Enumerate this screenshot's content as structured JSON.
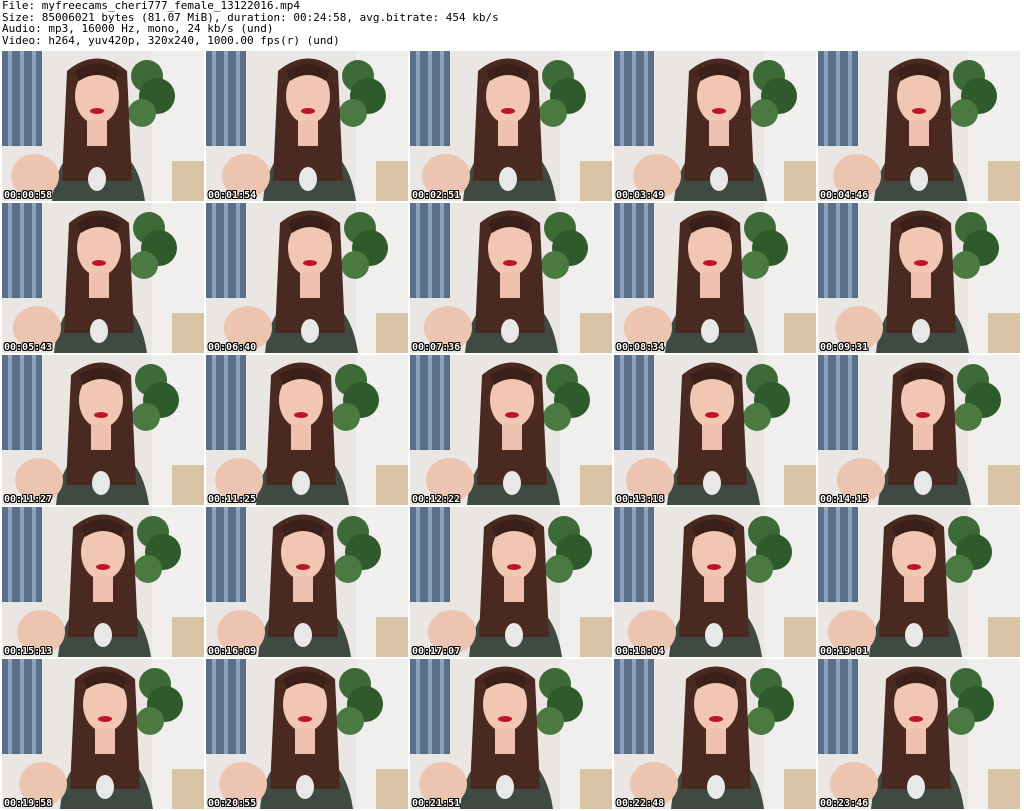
{
  "header": {
    "file_line": "File: myfreecams_cheri777_female_13122016.mp4",
    "size_line": "Size: 85006021 bytes (81.07 MiB), duration: 00:24:58, avg.bitrate: 454 kb/s",
    "audio_line": "Audio: mp3, 16000 Hz, mono, 24 kb/s (und)",
    "video_line": "Video: h264, yuv420p, 320x240, 1000.00 fps(r) (und)"
  },
  "thumbnails": [
    {
      "timestamp": "00:00:58"
    },
    {
      "timestamp": "00:01:54"
    },
    {
      "timestamp": "00:02:51"
    },
    {
      "timestamp": "00:03:49"
    },
    {
      "timestamp": "00:04:46"
    },
    {
      "timestamp": "00:05:43"
    },
    {
      "timestamp": "00:06:40"
    },
    {
      "timestamp": "00:07:36"
    },
    {
      "timestamp": "00:08:34"
    },
    {
      "timestamp": "00:09:31"
    },
    {
      "timestamp": "00:11:27"
    },
    {
      "timestamp": "00:11:25"
    },
    {
      "timestamp": "00:12:22"
    },
    {
      "timestamp": "00:13:18"
    },
    {
      "timestamp": "00:14:15"
    },
    {
      "timestamp": "00:15:13"
    },
    {
      "timestamp": "00:16:09"
    },
    {
      "timestamp": "00:17:07"
    },
    {
      "timestamp": "00:18:04"
    },
    {
      "timestamp": "00:19:01"
    },
    {
      "timestamp": "00:19:58"
    },
    {
      "timestamp": "00:20:55"
    },
    {
      "timestamp": "00:21:51"
    },
    {
      "timestamp": "00:22:48"
    },
    {
      "timestamp": "00:23:46"
    }
  ]
}
